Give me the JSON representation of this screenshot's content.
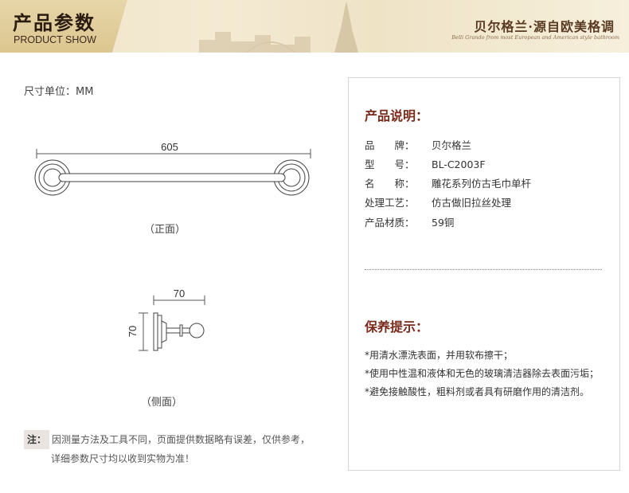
{
  "banner": {
    "title": "产品参数",
    "subtitle": "PRODUCT SHOW",
    "brand": "贝尔格兰·源自欧美格调",
    "brand_en": "Belli Grando from most European and American style bathroom"
  },
  "unit_label": "尺寸单位：MM",
  "front": {
    "dimension": "605",
    "label": "（正面）"
  },
  "side": {
    "width": "70",
    "height": "70",
    "label": "（侧面）"
  },
  "note": {
    "tag": "注：",
    "line1": "因测量方法及工具不同，页面提供数据略有误差，仅供参考，",
    "line2": "详细参数尺寸均以收到实物为准！"
  },
  "product_info": {
    "heading": "产品说明：",
    "specs": [
      {
        "key": "品　　牌：",
        "value": "贝尔格兰"
      },
      {
        "key": "型　　号：",
        "value": "BL-C2003F"
      },
      {
        "key": "名　　称：",
        "value": "雕花系列仿古毛巾单杆"
      },
      {
        "key": "处理工艺：",
        "value": "仿古做旧拉丝处理"
      },
      {
        "key": "产品材质：",
        "value": "59铜"
      }
    ]
  },
  "care": {
    "heading": "保养提示：",
    "tips": [
      "*用清水漂洗表面，并用软布擦干；",
      "*使用中性温和液体和无色的玻璃清洁器除去表面污垢；",
      "*避免接触酸性，粗料剂或者具有研磨作用的清洁剂。"
    ]
  }
}
